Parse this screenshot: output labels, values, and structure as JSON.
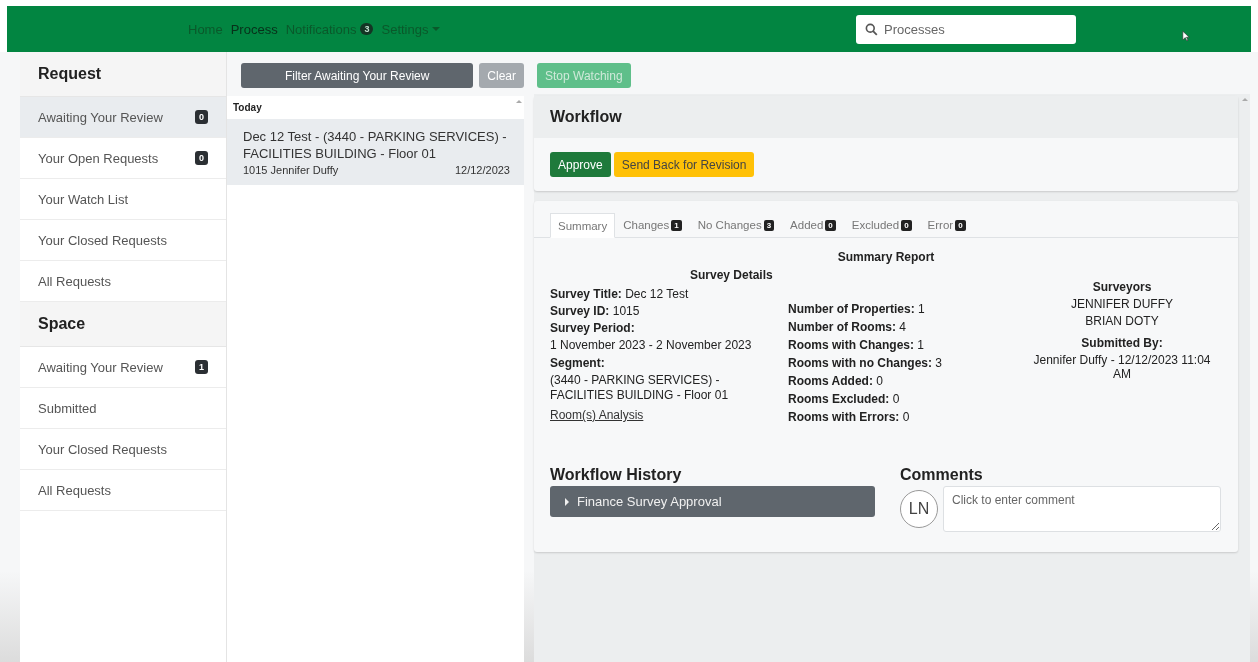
{
  "nav": {
    "items": [
      {
        "label": "Home",
        "selected": false
      },
      {
        "label": "Process",
        "selected": true
      },
      {
        "label": "Notifications",
        "selected": false,
        "badge": "3"
      },
      {
        "label": "Settings",
        "selected": false,
        "dropdown": true
      }
    ],
    "search": {
      "placeholder": "Processes"
    }
  },
  "sidebar": {
    "sections": [
      {
        "title": "Request",
        "items": [
          {
            "label": "Awaiting Your Review",
            "badge": "0",
            "selected": true
          },
          {
            "label": "Your Open Requests",
            "badge": "0",
            "selected": false
          },
          {
            "label": "Your Watch List",
            "selected": false
          },
          {
            "label": "Your Closed Requests",
            "selected": false
          },
          {
            "label": "All Requests",
            "selected": false
          }
        ]
      },
      {
        "title": "Space",
        "items": [
          {
            "label": "Awaiting Your Review",
            "badge": "1",
            "selected": false
          },
          {
            "label": "Submitted",
            "selected": false
          },
          {
            "label": "Your Closed Requests",
            "selected": false
          },
          {
            "label": "All Requests",
            "selected": false
          }
        ]
      }
    ]
  },
  "queue": {
    "filter_button": "Filter Awaiting Your Review",
    "clear_button": "Clear",
    "group": "Today",
    "items": [
      {
        "title": "Dec 12 Test - (3440 - PARKING SERVICES) - FACILITIES BUILDING - Floor 01",
        "meta": "1015 Jennifer Duffy",
        "date": "12/12/2023",
        "selected": true
      }
    ]
  },
  "detail": {
    "watch_button": "Stop Watching",
    "workflow": {
      "title": "Workflow",
      "approve_button": "Approve",
      "revise_button": "Send Back for Revision"
    },
    "tabs": [
      {
        "label": "Summary",
        "selected": true
      },
      {
        "label": "Changes",
        "badge": "1",
        "selected": false
      },
      {
        "label": "No Changes",
        "badge": "3",
        "selected": false
      },
      {
        "label": "Added",
        "badge": "0",
        "selected": false
      },
      {
        "label": "Excluded",
        "badge": "0",
        "selected": false
      },
      {
        "label": "Error",
        "badge": "0",
        "selected": false
      }
    ],
    "summary": {
      "title": "Summary Report",
      "details_title": "Survey Details",
      "left": [
        {
          "label": "Survey Title:",
          "value": "Dec 12 Test"
        },
        {
          "label": "Survey ID:",
          "value": "1015"
        },
        {
          "label": "Survey Period:",
          "value": "1 November 2023 - 2 November 2023",
          "block": true
        },
        {
          "label": "Segment:",
          "value": "(3440 - PARKING SERVICES) - FACILITIES BUILDING - Floor 01",
          "block": true
        }
      ],
      "link": "Room(s) Analysis",
      "middle": [
        {
          "label": "Number of Properties:",
          "value": "1"
        },
        {
          "label": "Number of Rooms:",
          "value": "4"
        },
        {
          "label": "Rooms with Changes:",
          "value": "1"
        },
        {
          "label": "Rooms with no Changes:",
          "value": "3"
        },
        {
          "label": "Rooms Added:",
          "value": "0"
        },
        {
          "label": "Rooms Excluded:",
          "value": "0"
        },
        {
          "label": "Rooms with Errors:",
          "value": "0"
        }
      ],
      "surveyors_title": "Surveyors",
      "surveyors": [
        "JENNIFER DUFFY",
        "BRIAN DOTY"
      ],
      "submitted_title": "Submitted By:",
      "submitted": "Jennifer Duffy - 12/12/2023 11:04 AM"
    },
    "history": {
      "title": "Workflow History",
      "items": [
        {
          "label": "Finance Survey Approval",
          "expanded": false
        }
      ]
    },
    "comments": {
      "title": "Comments",
      "avatar": "LN",
      "placeholder": "Click to enter comment"
    }
  }
}
